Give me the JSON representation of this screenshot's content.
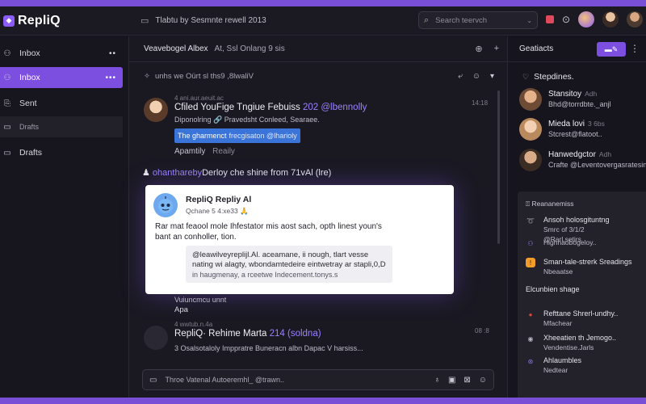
{
  "app": {
    "name": "RepliQ"
  },
  "header": {
    "title": "Tlabtu by Sesmnte rewell 2013",
    "search_placeholder": "Search teervch"
  },
  "sidebar": {
    "items": [
      {
        "label": "Inbox",
        "icon": "people-icon"
      },
      {
        "label": "Inbox",
        "icon": "inbox-icon"
      },
      {
        "label": "Sent",
        "icon": "sent-icon"
      },
      {
        "label": "Drafts",
        "icon": "drafts-icon"
      },
      {
        "label": "Drafts",
        "icon": "drafts-icon"
      }
    ]
  },
  "conversation": {
    "header": "Veavebogel Albex",
    "header_sub": "At, Ssl Onlang 9 sis",
    "subline": "unhs we Oürt sl ths9 ,8lwaliV",
    "messages": [
      {
        "meta": "4 ani.aur.aeuit.ac",
        "title": "Cfiled YouFige Tngiue Febuiss",
        "title_hl": "202 @lbennolly",
        "line": "Diponolring 🔗 Pravedsht Conleed, Searaee.",
        "chip": "The gharmenct",
        "chip_dim": "frecgisaton @lharioly",
        "reply": "Apamtily",
        "reply_dim": "Reaily",
        "time": "14:18"
      }
    ],
    "ai_prompt_prefix": "♟ ",
    "ai_prompt_hl": "ohanthareby",
    "ai_prompt": "Derloy che shine from 71vAl (lre)",
    "ai_card": {
      "name": "RepliQ Repliy Al",
      "sub": "Qchane 5 4:xe33 🙏",
      "body": "Rar mat feaool mole Ihfestator mis aost sach, opth linest youn's bant an conholler, tion.",
      "quote": "@leawilveyreplijl.Al. aceamane, ii nough, tlart vesse nating wi alagty, wbondamtedeire eintwetray ar stapli,0,D",
      "quote_cite": "in haugmenay, a rceetwe Indecement.tonys.s"
    },
    "after_card_meta": "Vuiuncmcu unnt",
    "after_card": "Apa",
    "second": {
      "meta": "4 wwtub.n.4a",
      "title": "RepliQ· Rehime Marta",
      "title_hl": "214 (soldna)",
      "line": "3 Osalsotaloly Imppratre Buneracn albn Dapac V harsiss...",
      "time": "08 :8"
    },
    "composer_placeholder": "Throe Vatenal Autoeremhl_ @trawn.."
  },
  "right": {
    "header": "Geatiacts",
    "section": "Stepdines.",
    "contacts": [
      {
        "name": "Stansitoy",
        "time": "Adh",
        "desc": "Bhd@torrdbte._anjl"
      },
      {
        "name": "Mieda lovi",
        "time": "3 6bs",
        "desc": "Stcrest@flatoot.."
      },
      {
        "name": "Hanwedgctor",
        "time": "Adh",
        "desc": "Crafte @Leventovergasratesin"
      }
    ],
    "panel_head": "Reananemiss",
    "panel_items": [
      {
        "l1": "Ansoh holosgituntng",
        "l2": "Smrc of 3/1/2",
        "l3": "",
        "color": "#8b5cf6"
      },
      {
        "l1": "@Rarl.setirs",
        "l2": "Highnaobogeloy..",
        "l3": "",
        "color": "#6a57c9"
      },
      {
        "l1": "Sman-tale-strerk Sreadings",
        "l2": "Nbeaatse",
        "l3": "",
        "color": "#f39c28"
      },
      {
        "l1": "Elcunbien shage",
        "l2": "",
        "l3": "",
        "color": "#00000000"
      },
      {
        "l1": "Refttane Shrerl-undhy..",
        "l2": "Mfachear",
        "l3": "",
        "color": "#d8463c"
      },
      {
        "l1": "Xheeatien th Jemogo..",
        "l2": "Vendentise.Jarls",
        "l3": "",
        "color": "#b5b5c4"
      },
      {
        "l1": "Ahlaumbles",
        "l2": "Nedtear",
        "l3": "",
        "color": "#6a57c9"
      }
    ]
  },
  "colors": {
    "accent": "#7c4fe0",
    "chip": "#3a74d8",
    "danger": "#e0485b"
  }
}
